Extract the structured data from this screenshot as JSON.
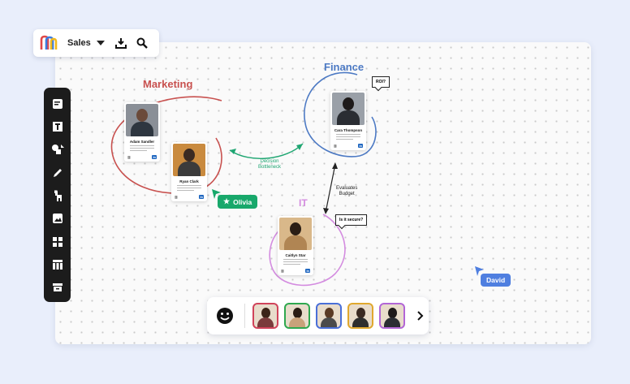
{
  "topbar": {
    "board_name": "Sales"
  },
  "toolbar": {
    "tools": [
      "sticky-note-icon",
      "text-icon",
      "shapes-icon",
      "pen-icon",
      "llama-icon",
      "image-icon",
      "grid-icon",
      "table-icon",
      "archive-icon"
    ]
  },
  "groups": {
    "marketing": {
      "label": "Marketing",
      "color": "#c8514f"
    },
    "finance": {
      "label": "Finance",
      "color": "#4d7ac4"
    },
    "it": {
      "label": "IT",
      "color": "#d48ce0"
    }
  },
  "cards": [
    {
      "name": "Adam Sandler"
    },
    {
      "name": "Ryan Clark"
    },
    {
      "name": "Cara Thompson"
    },
    {
      "name": "Caitlyn Star"
    }
  ],
  "connectors": {
    "marketing_finance": {
      "label": "Decision\nBottleneck",
      "color": "#1fa672"
    },
    "finance_it": {
      "label": "Evaluates\nBudget",
      "color": "#222222"
    }
  },
  "bubbles": {
    "finance": "ROI?",
    "it": "Is it secure?"
  },
  "cursors": {
    "olivia": {
      "name": "Olivia",
      "color": "#18a86b"
    },
    "david": {
      "name": "David",
      "color": "#4f7fe0"
    }
  },
  "collaborators": [
    {
      "border": "#d0435a"
    },
    {
      "border": "#2fa84f"
    },
    {
      "border": "#4a6fd8"
    },
    {
      "border": "#e0a82e"
    },
    {
      "border": "#b266d6"
    }
  ]
}
